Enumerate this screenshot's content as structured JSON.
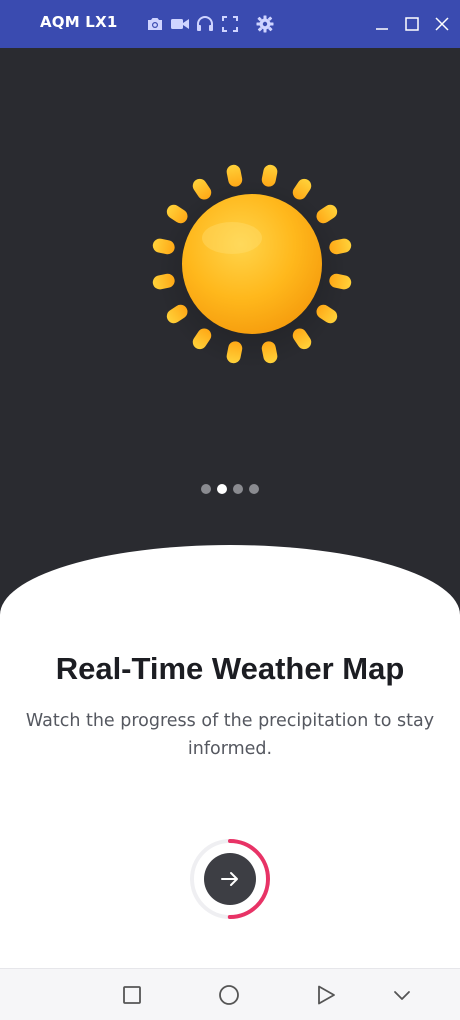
{
  "window": {
    "title": "AQM LX1",
    "toolbar_icons": [
      "camera-icon",
      "video-icon",
      "headphones-icon",
      "fullscreen-icon",
      "gear-icon"
    ],
    "controls": [
      "minimize-icon",
      "maximize-icon",
      "close-icon"
    ]
  },
  "onboarding": {
    "illustration": "sun-icon",
    "page_indicator": {
      "total": 4,
      "current": 2
    },
    "progress": 0.5,
    "title": "Real-Time Weather Map",
    "description": "Watch the progress of the precipitation to stay informed.",
    "next_icon": "arrow-right-icon"
  },
  "navbar": {
    "icons": [
      "square-icon",
      "circle-icon",
      "triangle-icon",
      "chevron-down-icon"
    ]
  },
  "colors": {
    "titlebar": "#3a4bb0",
    "background": "#2a2b30",
    "sheet": "#ffffff",
    "accent": "#e83366",
    "sun": "#ffb81c"
  }
}
